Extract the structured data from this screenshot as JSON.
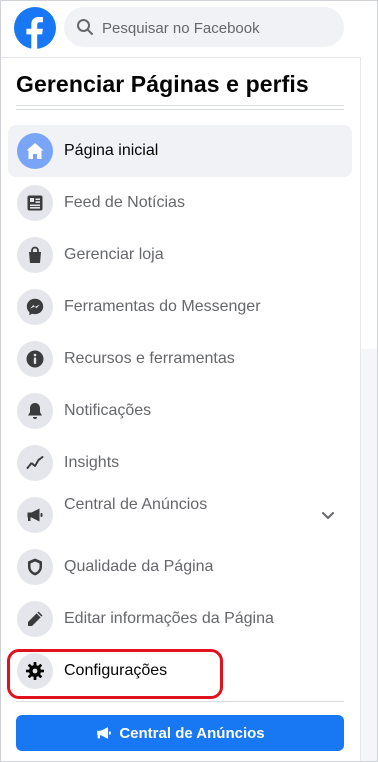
{
  "search": {
    "placeholder": "Pesquisar no Facebook"
  },
  "panel": {
    "title": "Gerenciar Páginas e perfis"
  },
  "nav": {
    "items": [
      {
        "label": "Página inicial",
        "icon": "home-icon",
        "active": true
      },
      {
        "label": "Feed de Notícias",
        "icon": "news-feed-icon"
      },
      {
        "label": "Gerenciar loja",
        "icon": "shopping-bag-icon"
      },
      {
        "label": "Ferramentas do Messenger",
        "icon": "messenger-icon"
      },
      {
        "label": "Recursos e ferramentas",
        "icon": "info-icon"
      },
      {
        "label": "Notificações",
        "icon": "bell-icon"
      },
      {
        "label": "Insights",
        "icon": "insights-icon"
      },
      {
        "label": "Central de Anúncios",
        "icon": "megaphone-icon",
        "expandable": true
      },
      {
        "label": "Qualidade da Página",
        "icon": "shield-icon"
      },
      {
        "label": "Editar informações da Página",
        "icon": "pencil-icon"
      },
      {
        "label": "Configurações",
        "icon": "gear-icon",
        "highlighted": true
      }
    ]
  },
  "cta": {
    "label": "Central de Anúncios",
    "icon": "megaphone-icon"
  },
  "colors": {
    "brand": "#1877f2",
    "highlight": "#e0121d",
    "active_icon_bg": "#7aa5f7"
  }
}
